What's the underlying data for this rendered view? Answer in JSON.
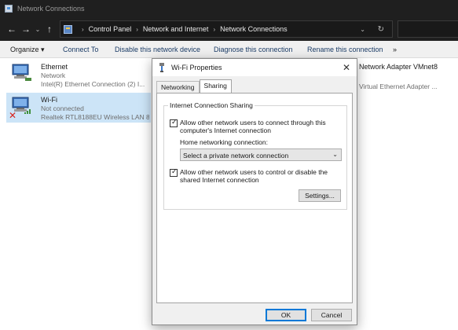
{
  "window": {
    "title": "Network Connections"
  },
  "address": {
    "breadcrumbs": [
      "Control Panel",
      "Network and Internet",
      "Network Connections"
    ]
  },
  "toolbar": {
    "organize": "Organize ▾",
    "connect_to": "Connect To",
    "disable": "Disable this network device",
    "diagnose": "Diagnose this connection",
    "rename": "Rename this connection",
    "more": "»"
  },
  "connections": [
    {
      "name": "Ethernet",
      "status": "Network",
      "device": "Intel(R) Ethernet Connection (2) I..."
    },
    {
      "name": "Wi-Fi",
      "status": "Not connected",
      "device": "Realtek RTL8188EU Wireless LAN 8..."
    },
    {
      "name": "Network Adapter VMnet8",
      "device": "Virtual Ethernet Adapter ..."
    }
  ],
  "dialog": {
    "title": "Wi-Fi Properties",
    "tabs": [
      "Networking",
      "Sharing"
    ],
    "active_tab": "Sharing",
    "group_title": "Internet Connection Sharing",
    "allow_connect_label": "Allow other network users to connect through this computer's Internet connection",
    "allow_connect_checked": true,
    "home_network_label": "Home networking connection:",
    "home_network_value": "Select a private network connection",
    "allow_control_label": "Allow other network users to control or disable the shared Internet connection",
    "allow_control_checked": true,
    "settings_button": "Settings...",
    "ok_button": "OK",
    "cancel_button": "Cancel"
  }
}
